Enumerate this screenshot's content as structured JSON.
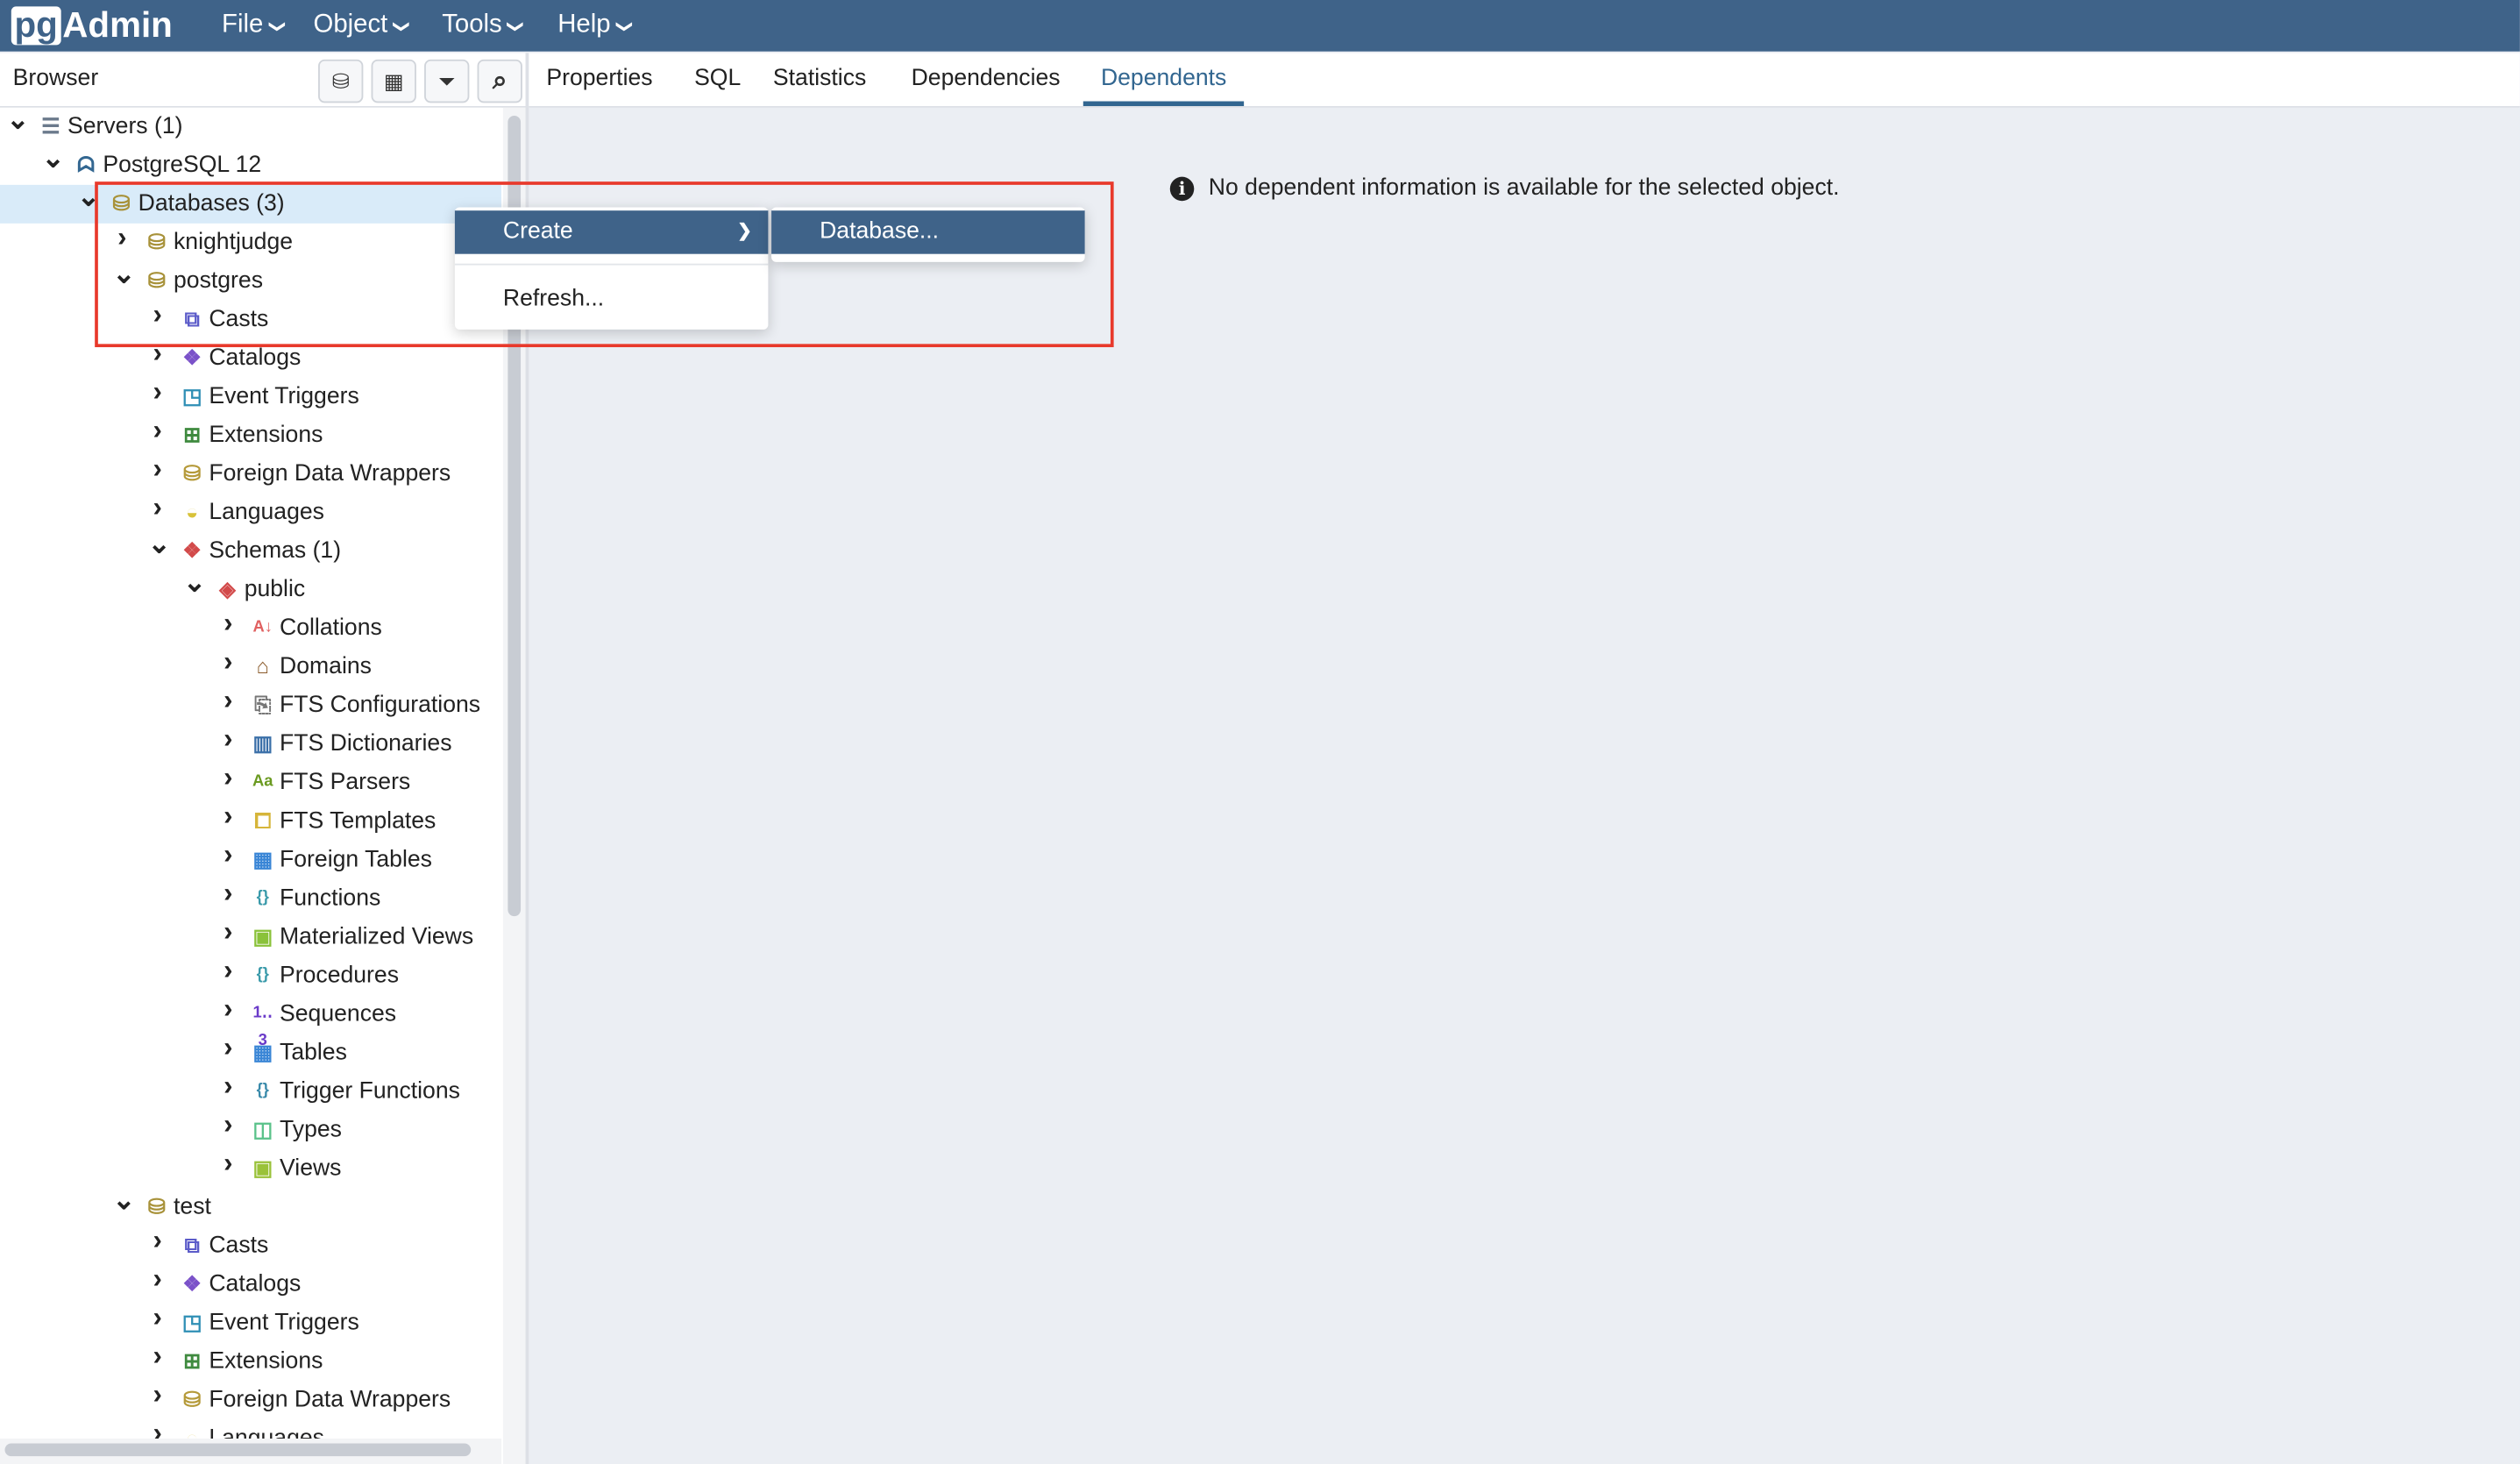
{
  "app": {
    "logo_pg": "pg",
    "logo_admin": "Admin"
  },
  "menubar": [
    {
      "label": "File"
    },
    {
      "label": "Object"
    },
    {
      "label": "Tools"
    },
    {
      "label": "Help"
    }
  ],
  "browser": {
    "title": "Browser",
    "toolbar": [
      {
        "icon": "query-tool-icon",
        "glyph": "⛁"
      },
      {
        "icon": "view-data-icon",
        "glyph": "▦"
      },
      {
        "icon": "filtered-rows-icon",
        "glyph": "⏷"
      },
      {
        "icon": "search-icon",
        "glyph": "⌕"
      }
    ]
  },
  "tabs": [
    {
      "label": "Properties",
      "active": false
    },
    {
      "label": "SQL",
      "active": false
    },
    {
      "label": "Statistics",
      "active": false
    },
    {
      "label": "Dependencies",
      "active": false
    },
    {
      "label": "Dependents",
      "active": true
    }
  ],
  "tree": [
    {
      "label": "Servers (1)",
      "level": 0,
      "state": "expanded",
      "icon": "servers-icon"
    },
    {
      "label": "PostgreSQL 12",
      "level": 1,
      "state": "expanded",
      "icon": "postgresql-elephant-icon"
    },
    {
      "label": "Databases (3)",
      "level": 2,
      "state": "expanded",
      "icon": "databases-icon",
      "selected": true
    },
    {
      "label": "knightjudge",
      "level": 3,
      "state": "collapsed",
      "icon": "database-icon"
    },
    {
      "label": "postgres",
      "level": 3,
      "state": "expanded",
      "icon": "database-icon"
    },
    {
      "label": "Casts",
      "level": 4,
      "state": "collapsed",
      "icon": "casts-icon"
    },
    {
      "label": "Catalogs",
      "level": 4,
      "state": "collapsed",
      "icon": "catalogs-icon"
    },
    {
      "label": "Event Triggers",
      "level": 4,
      "state": "collapsed",
      "icon": "event-triggers-icon"
    },
    {
      "label": "Extensions",
      "level": 4,
      "state": "collapsed",
      "icon": "extensions-icon"
    },
    {
      "label": "Foreign Data Wrappers",
      "level": 4,
      "state": "collapsed",
      "icon": "foreign-data-wrappers-icon"
    },
    {
      "label": "Languages",
      "level": 4,
      "state": "collapsed",
      "icon": "languages-icon"
    },
    {
      "label": "Schemas (1)",
      "level": 4,
      "state": "expanded",
      "icon": "schemas-icon"
    },
    {
      "label": "public",
      "level": 5,
      "state": "expanded",
      "icon": "schema-icon"
    },
    {
      "label": "Collations",
      "level": 6,
      "state": "collapsed",
      "icon": "collations-icon"
    },
    {
      "label": "Domains",
      "level": 6,
      "state": "collapsed",
      "icon": "domains-icon"
    },
    {
      "label": "FTS Configurations",
      "level": 6,
      "state": "collapsed",
      "icon": "fts-configurations-icon"
    },
    {
      "label": "FTS Dictionaries",
      "level": 6,
      "state": "collapsed",
      "icon": "fts-dictionaries-icon"
    },
    {
      "label": "FTS Parsers",
      "level": 6,
      "state": "collapsed",
      "icon": "fts-parsers-icon"
    },
    {
      "label": "FTS Templates",
      "level": 6,
      "state": "collapsed",
      "icon": "fts-templates-icon"
    },
    {
      "label": "Foreign Tables",
      "level": 6,
      "state": "collapsed",
      "icon": "foreign-tables-icon"
    },
    {
      "label": "Functions",
      "level": 6,
      "state": "collapsed",
      "icon": "functions-icon"
    },
    {
      "label": "Materialized Views",
      "level": 6,
      "state": "collapsed",
      "icon": "materialized-views-icon"
    },
    {
      "label": "Procedures",
      "level": 6,
      "state": "collapsed",
      "icon": "procedures-icon"
    },
    {
      "label": "Sequences",
      "level": 6,
      "state": "collapsed",
      "icon": "sequences-icon"
    },
    {
      "label": "Tables",
      "level": 6,
      "state": "collapsed",
      "icon": "tables-icon"
    },
    {
      "label": "Trigger Functions",
      "level": 6,
      "state": "collapsed",
      "icon": "trigger-functions-icon"
    },
    {
      "label": "Types",
      "level": 6,
      "state": "collapsed",
      "icon": "types-icon"
    },
    {
      "label": "Views",
      "level": 6,
      "state": "collapsed",
      "icon": "views-icon"
    },
    {
      "label": "test",
      "level": 3,
      "state": "expanded",
      "icon": "database-icon"
    },
    {
      "label": "Casts",
      "level": 4,
      "state": "collapsed",
      "icon": "casts-icon"
    },
    {
      "label": "Catalogs",
      "level": 4,
      "state": "collapsed",
      "icon": "catalogs-icon"
    },
    {
      "label": "Event Triggers",
      "level": 4,
      "state": "collapsed",
      "icon": "event-triggers-icon"
    },
    {
      "label": "Extensions",
      "level": 4,
      "state": "collapsed",
      "icon": "extensions-icon"
    },
    {
      "label": "Foreign Data Wrappers",
      "level": 4,
      "state": "collapsed",
      "icon": "foreign-data-wrappers-icon"
    },
    {
      "label": "Languages",
      "level": 4,
      "state": "collapsed",
      "icon": "languages-icon"
    }
  ],
  "context_menu": {
    "items": [
      {
        "label": "Create",
        "highlighted": true,
        "has_submenu": true
      },
      {
        "label": "Refresh...",
        "highlighted": false
      }
    ],
    "submenu": {
      "items": [
        {
          "label": "Database...",
          "highlighted": true
        }
      ]
    }
  },
  "main": {
    "message": "No dependent information is available for the selected object."
  },
  "colors": {
    "header": "#3f6389",
    "accent": "#326690",
    "selection": "#d9ebf9",
    "annotation_box": "#e8392b"
  }
}
